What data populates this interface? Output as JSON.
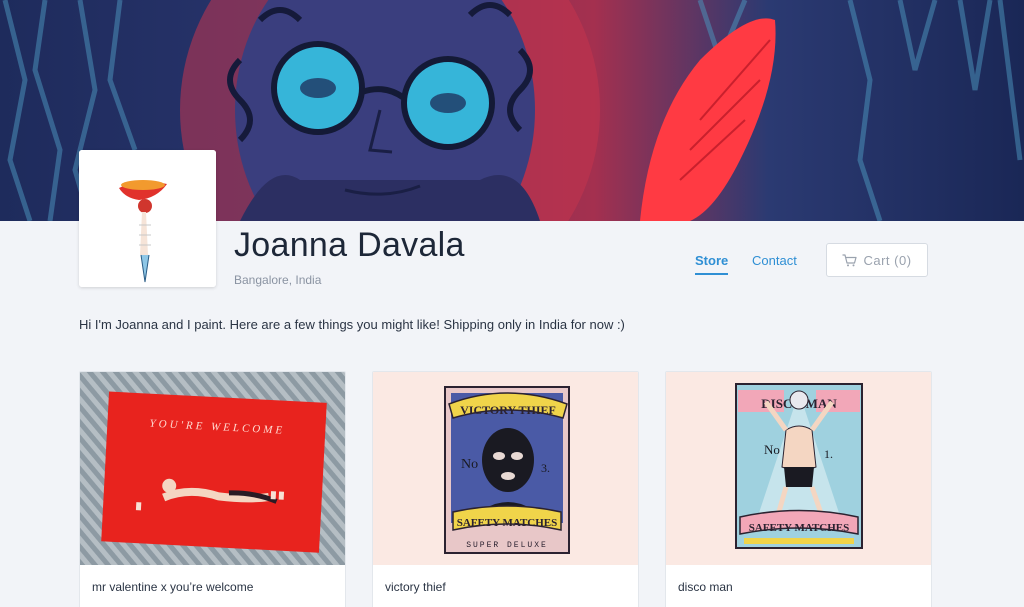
{
  "store": {
    "name": "Joanna Davala",
    "location": "Bangalore, India",
    "intro": "Hi I'm Joanna and I paint. Here are a few things you might like! Shipping only in India for now :)"
  },
  "nav": {
    "store_label": "Store",
    "contact_label": "Contact",
    "cart_label": "Cart (0)",
    "cart_icon": "shopping-cart-icon"
  },
  "products": [
    {
      "title": "mr valentine x you’re welcome",
      "image_text": "YOU'RE WELCOME"
    },
    {
      "title": "victory thief",
      "image_text": [
        "VICTORY THIEF",
        "No",
        "3.",
        "SAFETY MATCHES",
        "SUPER DELUXE"
      ]
    },
    {
      "title": "disco man",
      "image_text": [
        "DISCO MAN",
        "No",
        "1.",
        "SAFETY MATCHES"
      ]
    }
  ],
  "colors": {
    "accent": "#2f8fd4",
    "background": "#f2f4f8"
  }
}
